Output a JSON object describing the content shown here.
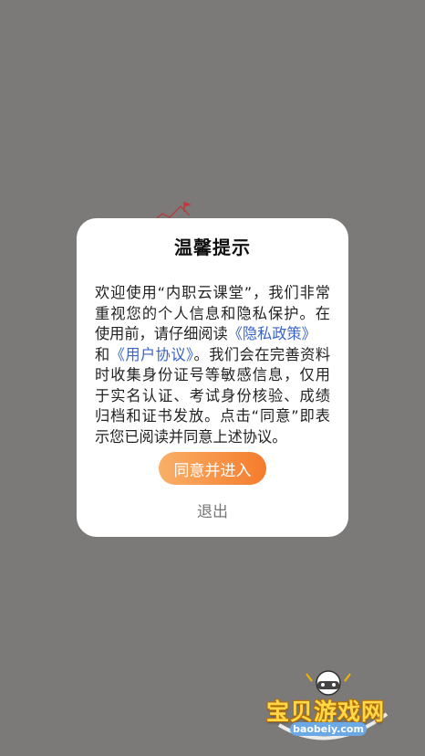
{
  "colors": {
    "backdrop": "#7b7a79",
    "dialog_background": "#ffffff",
    "link": "#3a63c7",
    "button_gradient_start": "#f9b068",
    "button_gradient_end": "#f57b2b"
  },
  "dialog": {
    "title": "温馨提示",
    "body": {
      "part1": "欢迎使用“内职云课堂”，我们非常重视您的个人信息和隐私保护。在使用前，请仔细阅读",
      "privacy_link": "《隐私政策》",
      "connector": "和",
      "user_agreement_link": "《用户协议》",
      "part2": "。我们会在完善资料时收集身份证号等敏感信息，仅用于实名认证、考试身份核验、成绩归档和证书发放。点击“同意”即表示您已阅读并同意上述协议。"
    },
    "agree_button": "同意并进入",
    "exit_button": "退出"
  },
  "watermark": {
    "logo_icon": "gamepad-mascot-icon",
    "text": "宝贝游戏网",
    "url": "baobeiy.com"
  }
}
